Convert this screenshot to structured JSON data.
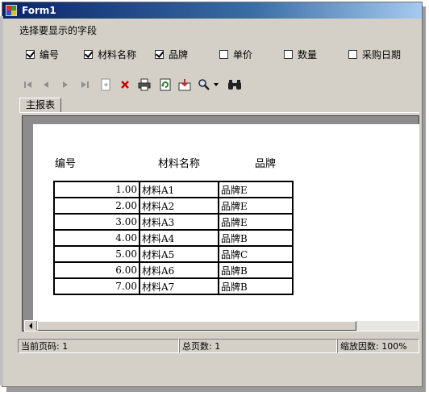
{
  "window": {
    "title": "Form1"
  },
  "fields_prompt": "选择要显示的字段",
  "field_checkboxes": [
    {
      "label": "编号",
      "checked": true
    },
    {
      "label": "材料名称",
      "checked": true
    },
    {
      "label": "品牌",
      "checked": true
    },
    {
      "label": "单价",
      "checked": false
    },
    {
      "label": "数量",
      "checked": false
    },
    {
      "label": "采购日期",
      "checked": false
    }
  ],
  "toolbar": {
    "buttons": [
      "first-page-icon",
      "prev-page-icon",
      "next-page-icon",
      "last-page-icon",
      "goto-page-icon",
      "close-icon",
      "print-icon",
      "refresh-icon",
      "export-icon",
      "zoom-icon",
      "dropdown-arrow-icon",
      "find-icon"
    ],
    "colors": {
      "close": "#cc0000",
      "refresh": "#2a8a2a",
      "find": "#222222"
    }
  },
  "tab": {
    "label": "主报表"
  },
  "report": {
    "headers": [
      "编号",
      "材料名称",
      "品牌"
    ],
    "rows": [
      [
        "1.00",
        "材料A1",
        "品牌E"
      ],
      [
        "2.00",
        "材料A2",
        "品牌E"
      ],
      [
        "3.00",
        "材料A3",
        "品牌E"
      ],
      [
        "4.00",
        "材料A4",
        "品牌B"
      ],
      [
        "5.00",
        "材料A5",
        "品牌C"
      ],
      [
        "6.00",
        "材料A6",
        "品牌B"
      ],
      [
        "7.00",
        "材料A7",
        "品牌B"
      ]
    ]
  },
  "status": {
    "current_page": "当前页码: 1",
    "total_pages": "总页数: 1",
    "zoom": "缩放因数: 100%"
  }
}
